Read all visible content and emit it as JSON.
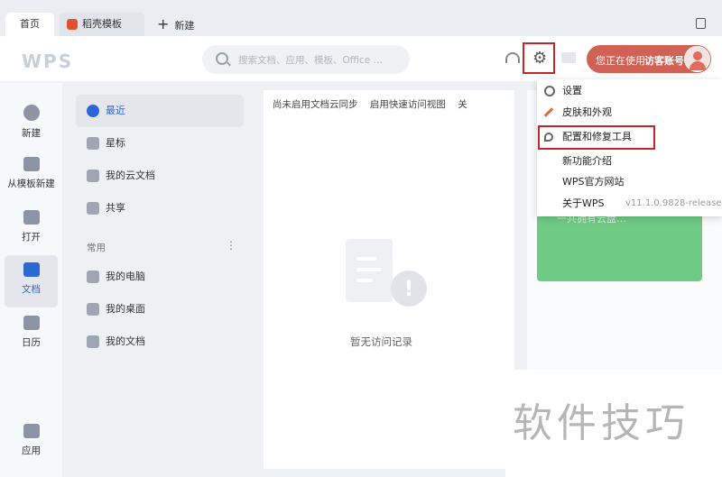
{
  "tabs": {
    "home": "首页",
    "daoke": "稻壳模板",
    "new": "新建"
  },
  "header": {
    "logo": "WPS",
    "search_placeholder": "搜索文档、应用、模板、Office …",
    "user_using": "您正在使用",
    "user_account": "访客账号"
  },
  "nav": [
    {
      "label": "新建",
      "icon": "plus-circle-icon"
    },
    {
      "label": "从模板新建",
      "icon": "template-icon"
    },
    {
      "label": "打开",
      "icon": "folder-icon"
    },
    {
      "label": "文档",
      "icon": "document-icon"
    },
    {
      "label": "日历",
      "icon": "calendar-icon"
    },
    {
      "label": "应用",
      "icon": "apps-icon"
    }
  ],
  "files": {
    "recent": "最近",
    "starred": "星标",
    "cloud": "我的云文档",
    "shared": "共享",
    "common": "常用",
    "more": "⋮",
    "pc": "我的电脑",
    "desktop": "我的桌面",
    "mydocs": "我的文档"
  },
  "main": {
    "sync_off": "尚未启用文档云同步",
    "quick_view": "启用快速访问视图",
    "close_short": "关",
    "empty": "暂无访问记录"
  },
  "menu": {
    "settings": "设置",
    "skin": "皮肤和外观",
    "repair": "配置和修复工具",
    "features": "新功能介绍",
    "website": "WPS官方网站",
    "about": "关于WPS",
    "version": "v11.1.0.9828-release"
  },
  "banner": {
    "text": "一共拥有云盘…"
  },
  "watermark": "软件技巧",
  "colors": {
    "accent": "#2d66d6",
    "user_btn": "#d16155",
    "highlight_box": "#c8222a",
    "banner": "#6fca84"
  }
}
